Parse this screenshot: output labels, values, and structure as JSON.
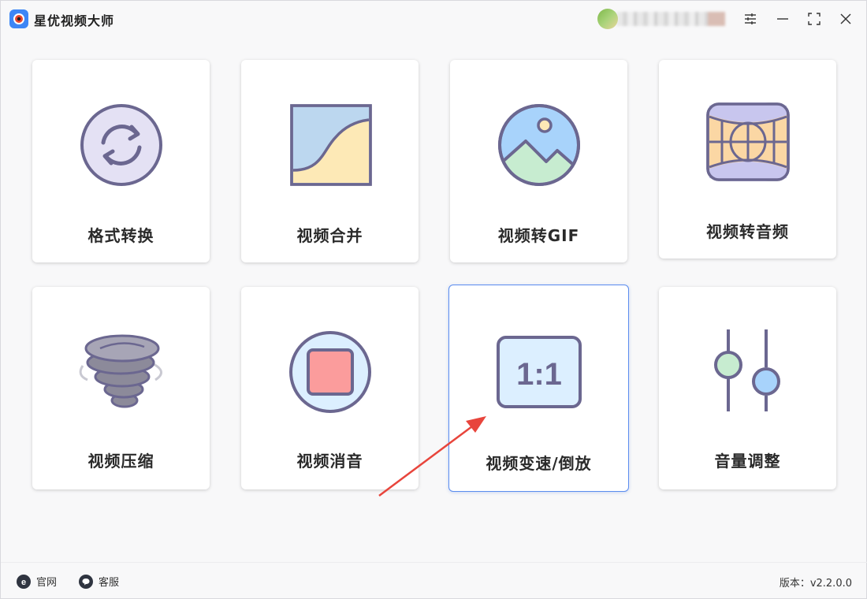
{
  "app": {
    "title": "星优视频大师"
  },
  "tiles": [
    {
      "label": "格式转换",
      "icon": "refresh-icon"
    },
    {
      "label": "视频合并",
      "icon": "merge-icon"
    },
    {
      "label": "视频转GIF",
      "icon": "image-icon"
    },
    {
      "label": "视频转音频",
      "icon": "audio-globe-icon"
    },
    {
      "label": "视频压缩",
      "icon": "tornado-icon"
    },
    {
      "label": "视频消音",
      "icon": "stop-icon"
    },
    {
      "label": "视频变速/倒放",
      "icon": "ratio-icon",
      "ratio_text": "1:1"
    },
    {
      "label": "音量调整",
      "icon": "sliders-icon"
    }
  ],
  "footer": {
    "website": "官网",
    "support": "客服",
    "version": "版本：v2.2.0.0"
  },
  "colors": {
    "accent": "#5b8def",
    "icon_stroke": "#6b6790",
    "arrow": "#e8453c"
  }
}
